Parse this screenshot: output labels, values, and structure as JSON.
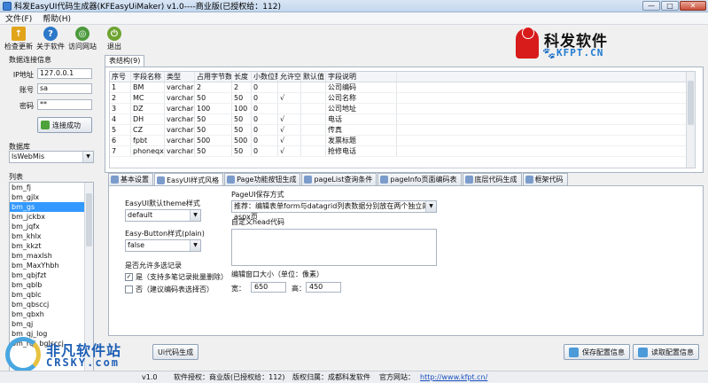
{
  "window": {
    "title": "科发EasyUI代码生成器(KFEasyUiMaker) v1.0----商业版(已授权给：112)",
    "min_label": "—",
    "max_label": "□",
    "close_label": "✕"
  },
  "menu": [
    "文件(F)",
    "帮助(H)"
  ],
  "toolbar": [
    {
      "label": "检查更新",
      "icon": "update-icon"
    },
    {
      "label": "关于软件",
      "icon": "help-icon"
    },
    {
      "label": "访问网站",
      "icon": "globe-icon"
    },
    {
      "label": "退出",
      "icon": "exit-icon"
    }
  ],
  "logo": {
    "name": "科发软件",
    "url": "KFPT.CN"
  },
  "connection": {
    "section_label": "数据连接信息",
    "ip_label": "IP地址",
    "ip_value": "127.0.0.1",
    "account_label": "账号",
    "account_value": "sa",
    "password_label": "密码",
    "password_value": "**",
    "connect_label": "连接成功"
  },
  "database": {
    "label": "数据库",
    "selected": "lsWebMis"
  },
  "list": {
    "label": "列表",
    "items": [
      "bm_fj",
      "bm_gjlx",
      "bm_gs",
      "bm_jckbx",
      "bm_jqfx",
      "bm_khlx",
      "bm_kkzt",
      "bm_maxlsh",
      "bm_MaxYhbh",
      "bm_qbjfzt",
      "bm_qblb",
      "bm_qblc",
      "bm_qbsccj",
      "bm_qbxh",
      "bm_qj",
      "bm_qj_log",
      "bm_rqj_bglsccj"
    ],
    "selected_index": 2
  },
  "table_tab": "表结构(9)",
  "grid": {
    "columns": [
      "序号",
      "字段名称",
      "类型",
      "占用字节数",
      "长度",
      "小数位数",
      "允许空",
      "默认值",
      "字段说明"
    ],
    "rows": [
      [
        "1",
        "BM",
        "varchar",
        "2",
        "2",
        "0",
        "",
        "",
        "公司编码"
      ],
      [
        "2",
        "MC",
        "varchar",
        "50",
        "50",
        "0",
        "√",
        "",
        "公司名称"
      ],
      [
        "3",
        "DZ",
        "varchar",
        "100",
        "100",
        "0",
        "",
        "",
        "公司地址"
      ],
      [
        "4",
        "DH",
        "varchar",
        "50",
        "50",
        "0",
        "√",
        "",
        "电话"
      ],
      [
        "5",
        "CZ",
        "varchar",
        "50",
        "50",
        "0",
        "√",
        "",
        "传真"
      ],
      [
        "6",
        "fpbt",
        "varchar",
        "500",
        "500",
        "0",
        "√",
        "",
        "发票标题"
      ],
      [
        "7",
        "phoneqx",
        "varchar",
        "50",
        "50",
        "0",
        "√",
        "",
        "抢修电话"
      ]
    ]
  },
  "settings_tabs": [
    "基本设置",
    "EasyUI样式风格",
    "Page功能按钮生成",
    "pageList查询条件",
    "pageInfo页面编码表",
    "底层代码生成",
    "框架代码"
  ],
  "settings_active": 1,
  "style": {
    "theme_label": "EasyUI默认theme样式",
    "theme_value": "default",
    "button_label": "Easy-Button样式(plain)",
    "button_value": "false",
    "multi_label": "是否允许多选记录",
    "multi_yes": "是（支持多笔记录批量删除）",
    "multi_no": "否（建议编码表选择否）",
    "save_mode_label": "PageUI保存方式",
    "save_mode_value": "推荐：编辑表单form与datagrid列表数据分别放在两个独立的aspx页",
    "head_label": "自定义head代码",
    "window_label": "编辑窗口大小（单位：像素）",
    "width_label": "宽：",
    "width_value": "650",
    "height_label": "高：",
    "height_value": "450"
  },
  "buttons": {
    "generate": "Ui代码生成",
    "save": "保存配置信息",
    "read": "读取配置信息"
  },
  "status": {
    "version": "v1.0",
    "license": "软件授权：商业版(已授权给：112)",
    "copyright": "版权归属：成都科发软件",
    "site_label": "官方网站：",
    "site_url": "http://www.kfpt.cn/"
  },
  "watermark": {
    "cn": "非凡软件站",
    "en": "CRSKY.com"
  }
}
